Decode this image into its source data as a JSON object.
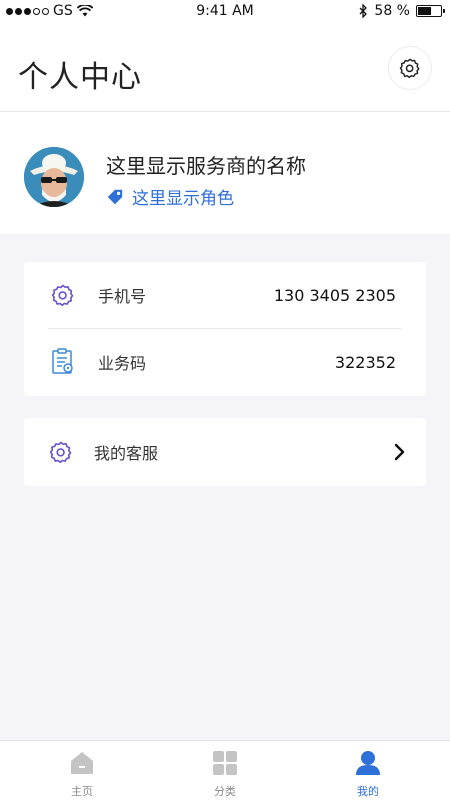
{
  "status_bar": {
    "carrier": "GS",
    "time": "9:41 AM",
    "battery": "58 %",
    "battery_level": 0.58
  },
  "header": {
    "title": "个人中心"
  },
  "profile": {
    "provider_name": "这里显示服务商的名称",
    "role": "这里显示角色"
  },
  "info": {
    "rows": [
      {
        "label": "手机号",
        "value": "130 3405 2305"
      },
      {
        "label": "业务码",
        "value": "322352"
      }
    ]
  },
  "service": {
    "label": "我的客服"
  },
  "tabbar": {
    "items": [
      {
        "label": "主页",
        "icon": "home-icon"
      },
      {
        "label": "分类",
        "icon": "grid-icon"
      },
      {
        "label": "我的",
        "icon": "user-icon",
        "active": true
      }
    ]
  },
  "colors": {
    "accent": "#2e6fd8",
    "icon_purple": "#6b4fd0",
    "background": "#f5f4f9"
  }
}
